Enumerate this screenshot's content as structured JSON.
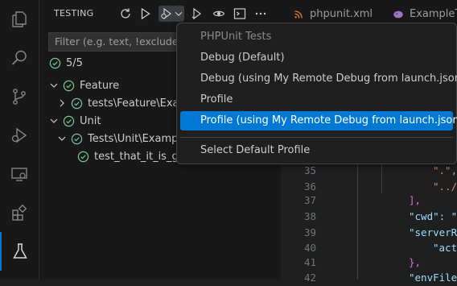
{
  "colors": {
    "accent": "#0078d4",
    "success": "#73c991",
    "json_key": "#9cdcfe",
    "json_string": "#ce9178",
    "bracket_yellow": "#ffd700",
    "bracket_purple": "#da70d6",
    "xml_icon": "#e37933",
    "php_icon": "#a074c4"
  },
  "activity_bar": {
    "items": [
      {
        "name": "explorer",
        "icon": "files-icon"
      },
      {
        "name": "search",
        "icon": "search-icon"
      },
      {
        "name": "source-control",
        "icon": "source-control-icon"
      },
      {
        "name": "run-debug",
        "icon": "debug-icon"
      },
      {
        "name": "remote-explorer",
        "icon": "remote-explorer-icon"
      },
      {
        "name": "extensions",
        "icon": "extensions-icon"
      },
      {
        "name": "testing",
        "icon": "beaker-icon",
        "active": true
      }
    ]
  },
  "sidebar": {
    "title": "TESTING",
    "toolbar": [
      "refresh-icon",
      "run-icon",
      "debug-test-icon",
      "chevron-down-icon",
      "run-with-coverage-icon",
      "watch-icon",
      "terminal-icon",
      "more-icon"
    ],
    "filter_placeholder": "Filter (e.g. text, !exclude, @",
    "summary": "5/5",
    "tree": [
      {
        "label": "Feature",
        "expanded": true,
        "level": 0
      },
      {
        "label": "tests\\Feature\\Examp",
        "expanded": false,
        "level": 1
      },
      {
        "label": "Unit",
        "expanded": true,
        "level": 0
      },
      {
        "label": "Tests\\Unit\\ExampleT",
        "expanded": true,
        "level": 1
      },
      {
        "label": "test_that_it_is_grea",
        "level": 2
      }
    ]
  },
  "editor": {
    "tabs": [
      {
        "label": "phpunit.xml",
        "icon": "rss-icon"
      },
      {
        "label": "ExampleTe",
        "icon": "php-elephant-icon"
      }
    ],
    "line_numbers": [
      "35",
      "36",
      "37",
      "38",
      "39",
      "40",
      "41",
      "42"
    ],
    "code": [
      {
        "text": "\".\","
      },
      {
        "text": "\"../"
      },
      {
        "text": "],"
      },
      {
        "text": "\"cwd\": \""
      },
      {
        "text": "\"serverR"
      },
      {
        "text": "\"act"
      },
      {
        "text": "},"
      },
      {
        "text": "\"envFile"
      }
    ]
  },
  "menu": {
    "header": "PHPUnit Tests",
    "items": [
      {
        "label": "Debug (Default)"
      },
      {
        "label": "Debug (using My Remote Debug from launch.json)"
      },
      {
        "label": "Profile"
      },
      {
        "label": "Profile (using My Remote Debug from launch.json)",
        "selected": true
      }
    ],
    "footer": "Select Default Profile"
  }
}
